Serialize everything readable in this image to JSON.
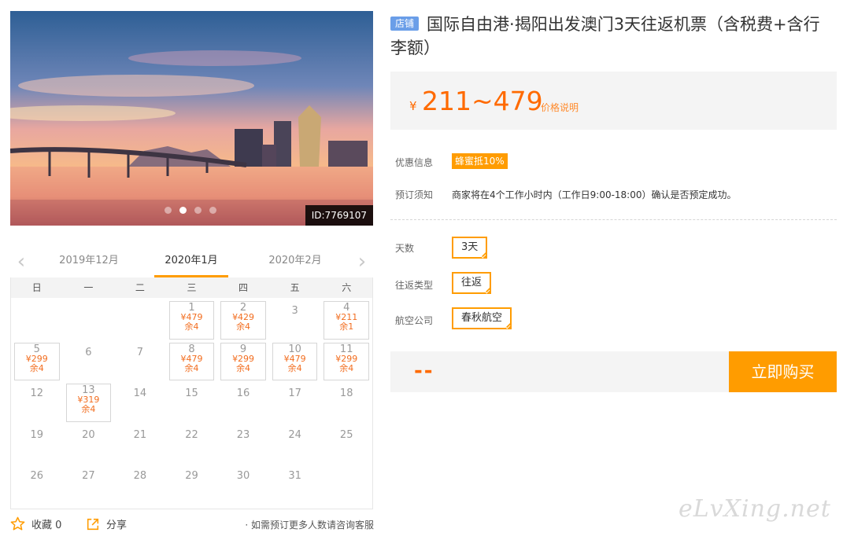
{
  "gallery": {
    "image_id": "ID:7769107",
    "slide_count": 4,
    "active_slide": 2
  },
  "calendar": {
    "prev_month": "2019年12月",
    "current_month": "2020年1月",
    "next_month": "2020年2月",
    "weekdays": [
      "日",
      "一",
      "二",
      "三",
      "四",
      "五",
      "六"
    ],
    "leading_blank_days": 3,
    "days": [
      {
        "d": "1",
        "price": "¥479",
        "stock": "余4"
      },
      {
        "d": "2",
        "price": "¥429",
        "stock": "余4"
      },
      {
        "d": "3"
      },
      {
        "d": "4",
        "price": "¥211",
        "stock": "余1"
      },
      {
        "d": "5",
        "price": "¥299",
        "stock": "余4"
      },
      {
        "d": "6"
      },
      {
        "d": "7"
      },
      {
        "d": "8",
        "price": "¥479",
        "stock": "余4"
      },
      {
        "d": "9",
        "price": "¥299",
        "stock": "余4"
      },
      {
        "d": "10",
        "price": "¥479",
        "stock": "余4"
      },
      {
        "d": "11",
        "price": "¥299",
        "stock": "余4"
      },
      {
        "d": "12"
      },
      {
        "d": "13",
        "price": "¥319",
        "stock": "余4"
      },
      {
        "d": "14"
      },
      {
        "d": "15"
      },
      {
        "d": "16"
      },
      {
        "d": "17"
      },
      {
        "d": "18"
      },
      {
        "d": "19"
      },
      {
        "d": "20"
      },
      {
        "d": "21"
      },
      {
        "d": "22"
      },
      {
        "d": "23"
      },
      {
        "d": "24"
      },
      {
        "d": "25"
      },
      {
        "d": "26"
      },
      {
        "d": "27"
      },
      {
        "d": "28"
      },
      {
        "d": "29"
      },
      {
        "d": "30"
      },
      {
        "d": "31"
      }
    ]
  },
  "actions": {
    "favorite_label": "收藏 0",
    "share_label": "分享",
    "consult_note": "· 如需预订更多人数请咨询客服"
  },
  "product": {
    "shop_badge": "店铺",
    "title": "国际自由港·揭阳出发澳门3天往返机票（含税费+含行李额）",
    "currency": "¥",
    "price_range": "211~479",
    "price_explain": "价格说明"
  },
  "info": {
    "promo_label": "优惠信息",
    "promo_tag": "蜂蜜抵10%",
    "notice_label": "预订须知",
    "notice_text": "商家将在4个工作小时内（工作日9:00-18:00）确认是否预定成功。"
  },
  "options": {
    "days_label": "天数",
    "days_value": "3天",
    "trip_label": "往返类型",
    "trip_value": "往返",
    "airline_label": "航空公司",
    "airline_value": "春秋航空"
  },
  "purchase": {
    "selected_price": "--",
    "buy_label": "立即购买"
  },
  "watermark": "eLvXing.net",
  "colors": {
    "accent": "#ff9c00",
    "price": "#ff6a00",
    "badge": "#6a9ee8"
  }
}
